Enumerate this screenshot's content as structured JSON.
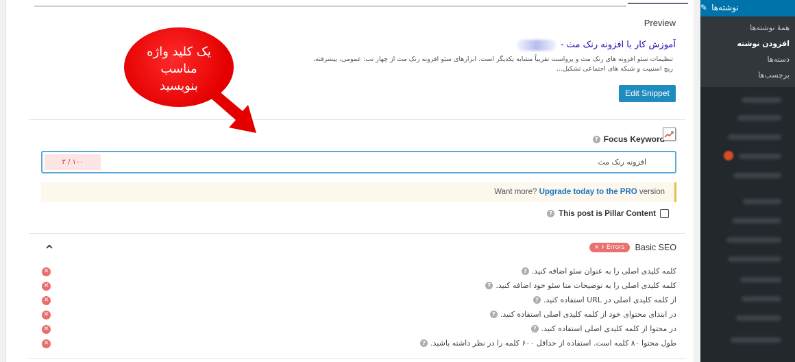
{
  "preview": {
    "label": "Preview",
    "snippet_title": "آموزش کار با افزونه رنک مث -",
    "snippet_description": "تنظیمات سئو افزونه های رنک مث و پرواست تقریباً مشابه یکدیگر است. ابزارهای سئو افزونه رنک مث از چهار تب: عمومی، پیشرفته، ریچ اسنیپت و شبکه های اجتماعی تشکیل...",
    "edit_button": "Edit Snippet"
  },
  "focus_keyword": {
    "label": "Focus Keyword",
    "value": "افزونه رنک مث",
    "counter": "۳ / ۱۰۰"
  },
  "upsell": {
    "prefix": "Want more? ",
    "link": "Upgrade today to the PRO",
    "suffix": " version"
  },
  "pillar": {
    "label": "This post is Pillar Content",
    "checked": false
  },
  "basic_seo": {
    "title": "Basic SEO",
    "errors_badge": "× ۶ Errors",
    "checks": [
      "کلمه کلیدی اصلی را به عنوان سئو اضافه کنید.",
      "کلمه کلیدی اصلی را به توضیحات متا سئو خود اضافه کنید.",
      "از کلمه کلیدی اصلی در URL استفاده کنید.",
      "در ابتدای محتوای خود از کلمه کلیدی اصلی استفاده کنید.",
      "در محتوا از کلمه کلیدی اصلی استفاده کنید.",
      "طول محتوا ۸۰ کلمه است. استفاده از حداقل ۶۰۰ کلمه را در نظر داشته باشید."
    ]
  },
  "annotation": {
    "line1": "یک کلید واژه",
    "line2": "مناسب",
    "line3": "بنویسید"
  },
  "sidebar": {
    "header": "نوشته‌ها",
    "items": [
      "همهٔ نوشته‌ها",
      "افزودن نوشته",
      "دسته‌ها",
      "برچسب‌ها"
    ],
    "active_index": 1
  },
  "colors": {
    "accent": "#1e8cbe",
    "error": "#e96f6d",
    "link": "#1e73be",
    "annotation": "#e40000",
    "sidebar_bg": "#23282d"
  }
}
